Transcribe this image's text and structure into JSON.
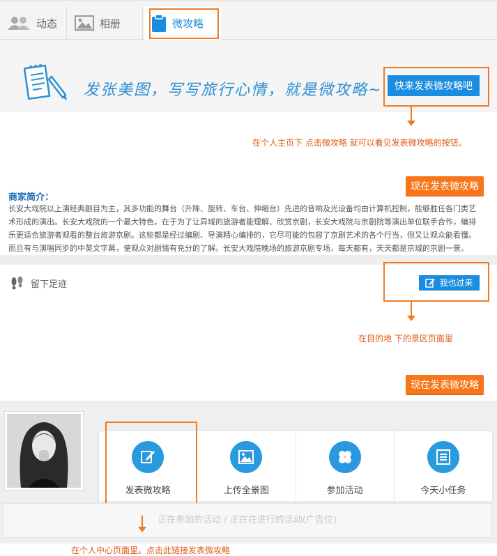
{
  "tabs": [
    {
      "label": "动态",
      "icon": "users-icon"
    },
    {
      "label": "相册",
      "icon": "image-icon"
    },
    {
      "label": "微攻略",
      "icon": "clipboard-icon",
      "active": true
    }
  ],
  "banner": {
    "slogan": "发张美图，写写旅行心情，就是微攻略~",
    "button": "快来发表微攻略吧"
  },
  "annotations": {
    "a1": "在个人主页下  点击微攻略  就可以看见发表微攻略的按钮。",
    "a2": "在目的地  下的景区页面里",
    "a3": "在个人中心页面里。点击此链接发表微攻略"
  },
  "publish_now": "现在发表微攻略",
  "merchant": {
    "title": "商家简介：",
    "text": "长安大戏院以上演经典剧目为主，其多功能的舞台（升降、旋转、车台、伸缩台）先进的音响及光设备均由计算机控制，能够胜任各门类艺术形成的演出。长安大戏院的一个最大特色，在于为了让异域的旅游者能理解、欣赏京剧，长安大戏院与京剧院等演出单位联手合作，编排乐更适合旅游者观看的整台旅游京剧。这些都是经过编剧、导演精心编排的，它尽可能的包容了京剧艺术的各个行当，但又让观众能看懂。而且有与演唱同步的中英文字幕，使观众对剧情有充分的了解。长安大戏院晚场的旅游京剧专场，每天都有，天天都是京城的京剧一景。"
  },
  "footprint": {
    "label": "留下足迹",
    "button": "我也过来"
  },
  "user_center": {
    "actions": [
      {
        "label": "发表微攻略",
        "icon": "edit-icon"
      },
      {
        "label": "上传全景图",
        "icon": "picture-icon"
      },
      {
        "label": "参加活动",
        "icon": "clover-icon"
      },
      {
        "label": "今天小任务",
        "icon": "list-icon"
      }
    ],
    "ad_text": "正在参加的活动 / 正在在进行的活动(广告位)"
  },
  "colors": {
    "accent": "#1a8de0",
    "highlight": "#f07a22",
    "publish": "#f7761a"
  }
}
